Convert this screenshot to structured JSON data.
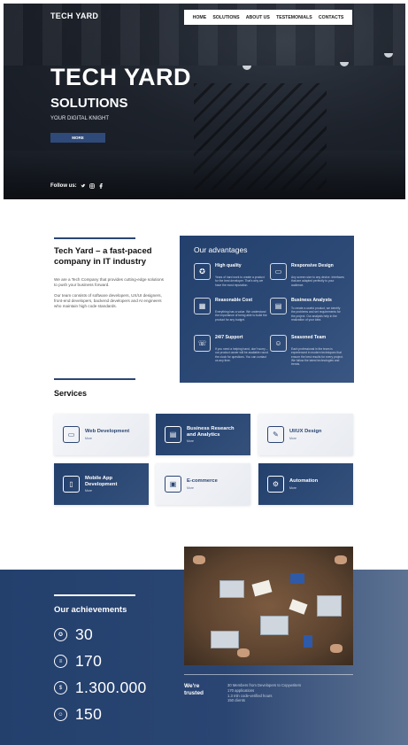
{
  "header": {
    "logo": "TECH YARD",
    "nav": [
      "HOME",
      "SOLUTIONS",
      "ABOUT US",
      "TESTEMONIALS",
      "CONTACTS"
    ]
  },
  "hero": {
    "title": "TECH YARD",
    "subtitle": "SOLUTIONS",
    "tagline": "YOUR DIGITAL KNIGHT",
    "button": "MORE",
    "follow_label": "Follow us:",
    "social_icons": [
      "twitter-icon",
      "instagram-icon",
      "facebook-icon"
    ]
  },
  "about": {
    "title_line1": "Tech Yard – a fast-paced",
    "title_line2": "company in IT industry",
    "paragraph1": "We are a Tech Company that provides cutting-edge solutions to push your business forward.",
    "paragraph2": "Our team consists of software developers, UX/UI designers, front-end developers, backend developers and AI engineers who maintain high code standards."
  },
  "advantages": {
    "title": "Our advantages",
    "items": [
      {
        "icon": "award-icon",
        "title": "High quality",
        "desc": "Years of hard work to create a product for the best developer. That's why we have the most reputation."
      },
      {
        "icon": "monitor-icon",
        "title": "Responsive Design",
        "desc": "Any screen size to any device. Interfaces that are adapted perfectly to your audience."
      },
      {
        "icon": "calculator-icon",
        "title": "Reasonable Cost",
        "desc": "Everything has a value. We understand the importance of being able to build the product for any budget."
      },
      {
        "icon": "chart-icon",
        "title": "Business Analysts",
        "desc": "To create a useful product, we identify the problems and set requirements for the project. Our analysts help in the realization of your idea."
      },
      {
        "icon": "support-icon",
        "title": "24/7 Support",
        "desc": "If you need a helping hand, don't worry – our product owner will be available round the clock for questions. You can contact us any time."
      },
      {
        "icon": "team-icon",
        "title": "Seasoned Team",
        "desc": "Each professional in the team is experienced in modern techniques that ensure the best results for every project. We follow the latest technologies and trends."
      }
    ]
  },
  "services": {
    "title": "Services",
    "items": [
      {
        "icon": "web-icon",
        "title": "Web Development",
        "more": "More",
        "style": "light"
      },
      {
        "icon": "research-icon",
        "title": "Business Research and Analytics",
        "more": "More",
        "style": "dark"
      },
      {
        "icon": "design-icon",
        "title": "UI/UX Design",
        "more": "More",
        "style": "light"
      },
      {
        "icon": "mobile-icon",
        "title": "Mobile App Development",
        "more": "More",
        "style": "dark"
      },
      {
        "icon": "cart-icon",
        "title": "E-commerce",
        "more": "More",
        "style": "light"
      },
      {
        "icon": "gears-icon",
        "title": "Automation",
        "more": "More",
        "style": "dark"
      }
    ]
  },
  "achievements": {
    "title": "Our achievements",
    "items": [
      {
        "icon": "medal-icon",
        "value": "30"
      },
      {
        "icon": "document-icon",
        "value": "170"
      },
      {
        "icon": "coins-icon",
        "value": "1.300.000"
      },
      {
        "icon": "people-icon",
        "value": "150"
      }
    ]
  },
  "trusted": {
    "title_line1": "We're",
    "title_line2": "trusted",
    "lines": [
      "30 Members from Developers to Copywriters",
      "170 applications",
      "1.3 mln code-verified hours",
      "150 clients"
    ]
  }
}
